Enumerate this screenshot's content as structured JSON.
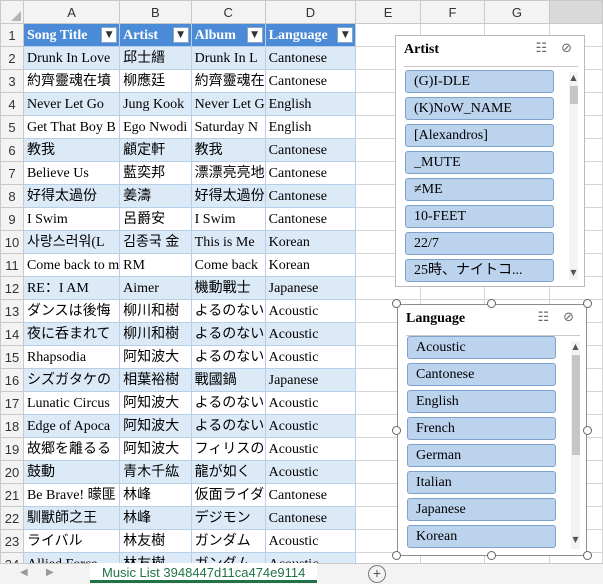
{
  "columns": [
    "A",
    "B",
    "C",
    "D",
    "E",
    "F",
    "G"
  ],
  "header": [
    "Song Title",
    "Artist",
    "Album",
    "Language"
  ],
  "rows": [
    {
      "n": "1",
      "cells": [
        "",
        "",
        "",
        ""
      ]
    },
    {
      "n": "2",
      "cells": [
        "Drunk In Love",
        "邱士縉",
        "Drunk In L",
        "Cantonese"
      ]
    },
    {
      "n": "3",
      "cells": [
        "約齊靈魂在墳",
        "柳應廷",
        "約齊靈魂在",
        "Cantonese"
      ]
    },
    {
      "n": "4",
      "cells": [
        "Never Let Go",
        "Jung Kook",
        "Never Let G",
        "English"
      ]
    },
    {
      "n": "5",
      "cells": [
        "Get That Boy B",
        "Ego Nwodi",
        "Saturday N",
        "English"
      ]
    },
    {
      "n": "6",
      "cells": [
        "教我",
        "顧定軒",
        "教我",
        "Cantonese"
      ]
    },
    {
      "n": "7",
      "cells": [
        "Believe Us",
        "藍奕邦",
        "漂漂亮亮地",
        "Cantonese"
      ]
    },
    {
      "n": "8",
      "cells": [
        "好得太過份",
        "姜濤",
        "好得太過份",
        "Cantonese"
      ]
    },
    {
      "n": "9",
      "cells": [
        "I Swim",
        "呂爵安",
        "I Swim",
        "Cantonese"
      ]
    },
    {
      "n": "10",
      "cells": [
        "사랑스러워(L",
        "김종국 金",
        "This is Me",
        "Korean"
      ]
    },
    {
      "n": "11",
      "cells": [
        "Come back to m",
        "RM",
        "Come back",
        "Korean"
      ]
    },
    {
      "n": "12",
      "cells": [
        "RE：I AM",
        "Aimer",
        "機動戰士",
        "Japanese"
      ]
    },
    {
      "n": "13",
      "cells": [
        "ダンスは後悔",
        "柳川和樹",
        "よるのない",
        "Acoustic"
      ]
    },
    {
      "n": "14",
      "cells": [
        "夜に呑まれて",
        "柳川和樹",
        "よるのない",
        "Acoustic"
      ]
    },
    {
      "n": "15",
      "cells": [
        "Rhapsodia",
        "阿知波大",
        "よるのない",
        "Acoustic"
      ]
    },
    {
      "n": "16",
      "cells": [
        "シズガタケの",
        "相葉裕樹",
        "戰國鍋",
        "Japanese"
      ]
    },
    {
      "n": "17",
      "cells": [
        "Lunatic Circus",
        "阿知波大",
        "よるのない",
        "Acoustic"
      ]
    },
    {
      "n": "18",
      "cells": [
        "Edge of Apoca",
        "阿知波大",
        "よるのない",
        "Acoustic"
      ]
    },
    {
      "n": "19",
      "cells": [
        "故郷を離るる",
        "阿知波大",
        "フィリスの",
        "Acoustic"
      ]
    },
    {
      "n": "20",
      "cells": [
        "鼓動",
        "青木千紘",
        "龍が如く",
        "Acoustic"
      ]
    },
    {
      "n": "21",
      "cells": [
        "Be Brave! 曚匪",
        "林峰",
        "仮面ライダ",
        "Cantonese"
      ]
    },
    {
      "n": "22",
      "cells": [
        "馴獸師之王",
        "林峰",
        "デジモン",
        "Cantonese"
      ]
    },
    {
      "n": "23",
      "cells": [
        "ライバル",
        "林友樹",
        "ガンダム",
        "Acoustic"
      ]
    },
    {
      "n": "24",
      "cells": [
        "Allied Force",
        "林友樹",
        "ガンダム",
        "Acoustic"
      ]
    }
  ],
  "slicer_artist": {
    "title": "Artist",
    "items": [
      "(G)I-DLE",
      "(K)NoW_NAME",
      "[Alexandros]",
      "_MUTE",
      "≠ME",
      "10-FEET",
      "22/7",
      "25時、ナイトコ..."
    ]
  },
  "slicer_language": {
    "title": "Language",
    "items": [
      "Acoustic",
      "Cantonese",
      "English",
      "French",
      "German",
      "Italian",
      "Japanese",
      "Korean"
    ]
  },
  "sheet_tab": "Music List 3948447d11ca474e9114",
  "icons": {
    "multiselect": "multi-select-icon",
    "clear": "clear-filter-icon",
    "dropdown": "filter-dropdown-icon"
  }
}
